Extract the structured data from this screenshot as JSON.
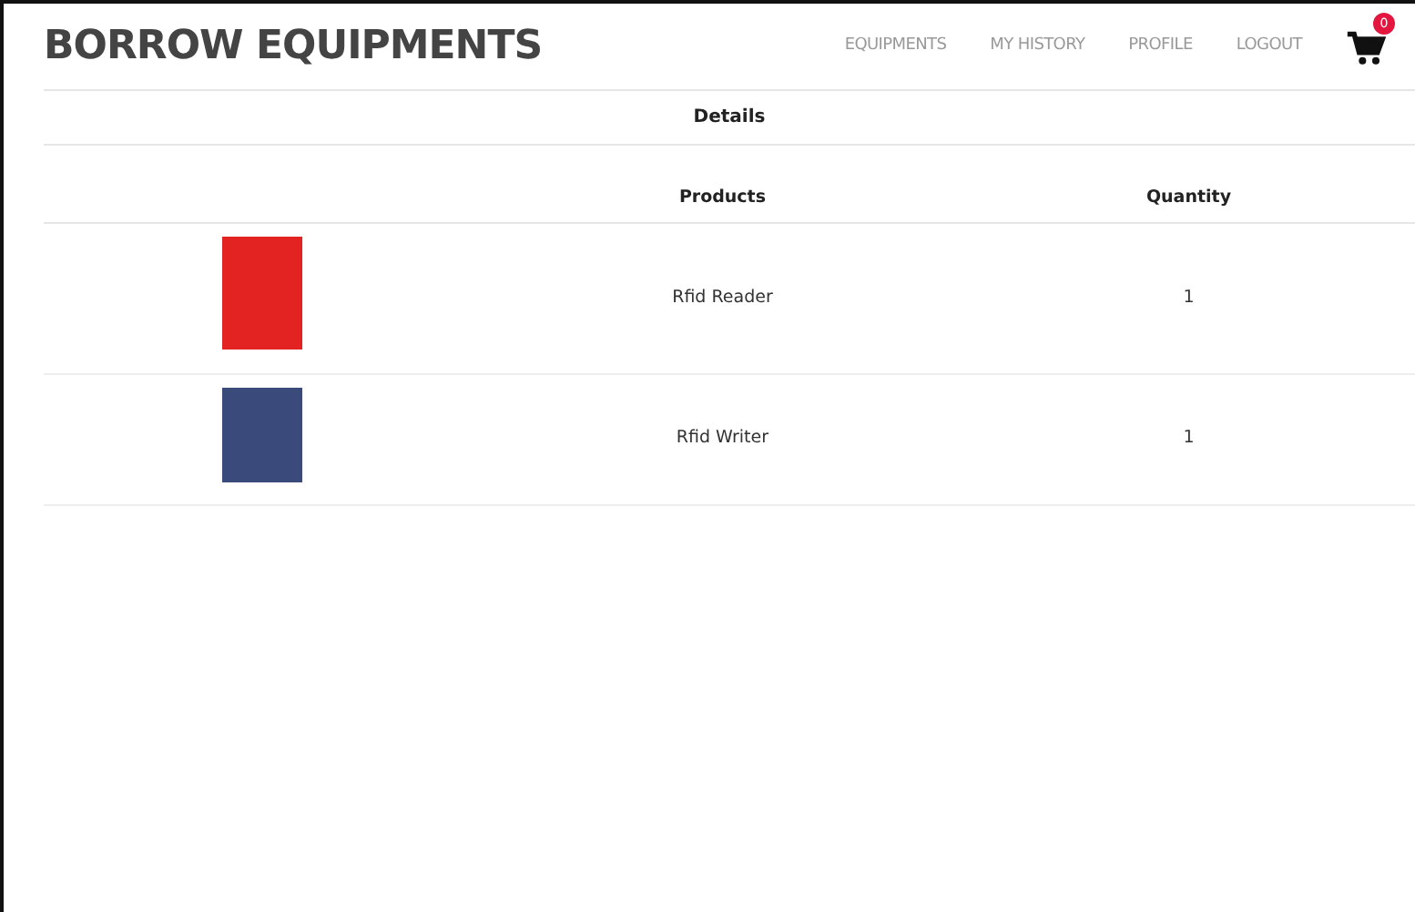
{
  "brand": "BORROW EQUIPMENTS",
  "nav": [
    {
      "label": "EQUIPMENTS"
    },
    {
      "label": "MY HISTORY"
    },
    {
      "label": "PROFILE"
    },
    {
      "label": "LOGOUT"
    }
  ],
  "cart_count": "0",
  "section_title": "Details",
  "columns": [
    "Products",
    "Quantity"
  ],
  "rows": [
    {
      "product": "Rfid Reader",
      "quantity": "1",
      "kind": "red"
    },
    {
      "product": "Rfid Writer",
      "quantity": "1",
      "kind": "device"
    }
  ]
}
